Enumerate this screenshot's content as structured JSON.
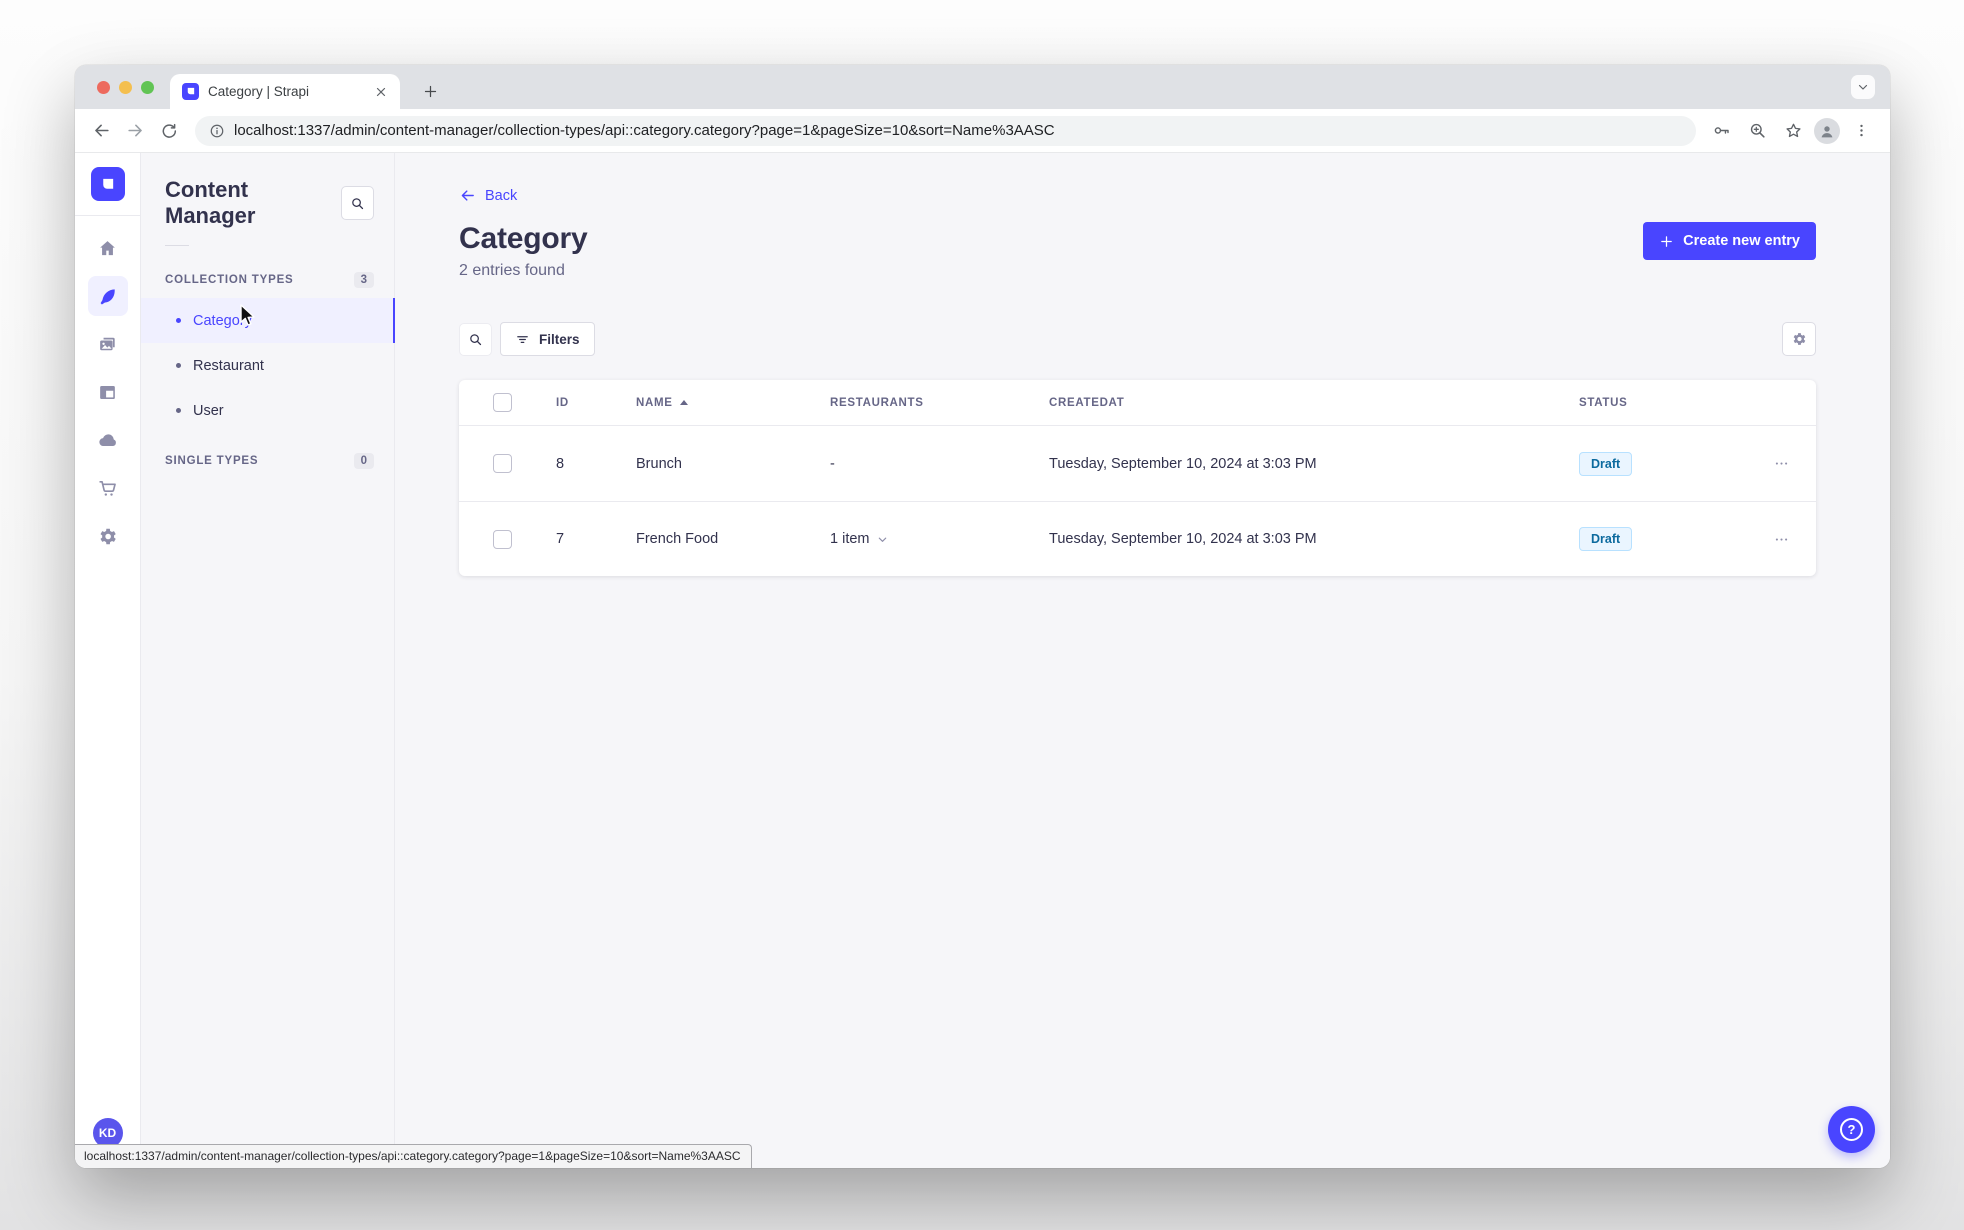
{
  "browser": {
    "tab_title": "Category | Strapi",
    "url": "localhost:1337/admin/content-manager/collection-types/api::category.category?page=1&pageSize=10&sort=Name%3AASC",
    "status_url": "localhost:1337/admin/content-manager/collection-types/api::category.category?page=1&pageSize=10&sort=Name%3AASC"
  },
  "nav": {
    "items": [
      {
        "name": "home",
        "active": false
      },
      {
        "name": "content-manager",
        "active": true
      },
      {
        "name": "media-library",
        "active": false
      },
      {
        "name": "content-type-builder",
        "active": false
      },
      {
        "name": "cloud",
        "active": false
      },
      {
        "name": "marketplace",
        "active": false
      },
      {
        "name": "settings",
        "active": false
      }
    ],
    "avatar_initials": "KD"
  },
  "subnav": {
    "title": "Content Manager",
    "collection_types": {
      "label": "COLLECTION TYPES",
      "count": "3",
      "items": [
        {
          "label": "Category",
          "active": true
        },
        {
          "label": "Restaurant",
          "active": false
        },
        {
          "label": "User",
          "active": false
        }
      ]
    },
    "single_types": {
      "label": "SINGLE TYPES",
      "count": "0"
    }
  },
  "main": {
    "back_label": "Back",
    "title": "Category",
    "subtitle": "2 entries found",
    "create_button": "Create new entry",
    "filters_button": "Filters",
    "table": {
      "columns": [
        "ID",
        "NAME",
        "RESTAURANTS",
        "CREATEDAT",
        "STATUS"
      ],
      "sorted_column": "NAME",
      "sort_direction": "ASC",
      "rows": [
        {
          "id": "8",
          "name": "Brunch",
          "restaurants": "-",
          "created_at": "Tuesday, September 10, 2024 at 3:03 PM",
          "status": "Draft"
        },
        {
          "id": "7",
          "name": "French Food",
          "restaurants": "1 item",
          "created_at": "Tuesday, September 10, 2024 at 3:03 PM",
          "status": "Draft"
        }
      ]
    }
  },
  "help_label": "?",
  "colors": {
    "accent": "#4945ff",
    "active_item_bg": "#f0f0ff",
    "draft_bg": "#eaf5ff",
    "draft_border": "#b8e1ff",
    "draft_text": "#0c6a9e"
  }
}
